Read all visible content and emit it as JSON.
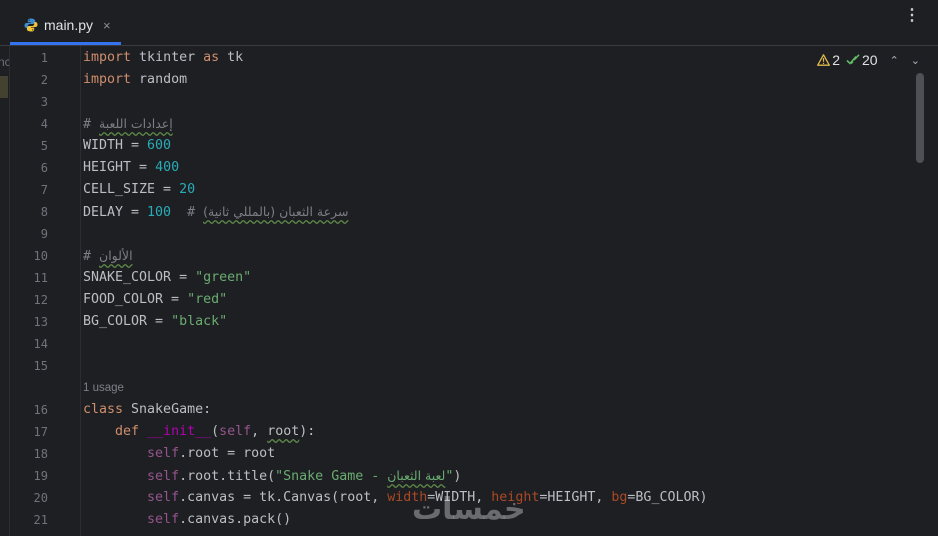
{
  "tab": {
    "filename": "main.py",
    "close": "×"
  },
  "menu": {
    "more": "⋮"
  },
  "left_strip": {
    "text": "nc"
  },
  "inspections": {
    "warnings": "2",
    "weak_warnings": "20",
    "prev": "⌃",
    "next": "⌄"
  },
  "line_numbers": [
    "1",
    "2",
    "3",
    "4",
    "5",
    "6",
    "7",
    "8",
    "9",
    "10",
    "11",
    "12",
    "13",
    "14",
    "15",
    "16",
    "17",
    "18",
    "19",
    "20",
    "21"
  ],
  "code": {
    "l1": {
      "k": "import",
      "t": " tkinter ",
      "k2": "as",
      "t2": " tk"
    },
    "l2": {
      "k": "import",
      "t": " random"
    },
    "l4": {
      "hash": "# ",
      "ar": "إعدادات اللعبة"
    },
    "l5": {
      "name": "WIDTH = ",
      "num": "600"
    },
    "l6": {
      "name": "HEIGHT = ",
      "num": "400"
    },
    "l7": {
      "name": "CELL_SIZE = ",
      "num": "20"
    },
    "l8": {
      "name": "DELAY = ",
      "num": "100",
      "hash": "  # ",
      "ar": "سرعة الثعبان (بالمللي ثانية)"
    },
    "l10": {
      "hash": "# ",
      "ar": "الألوان"
    },
    "l11": {
      "name": "SNAKE_COLOR = ",
      "str": "\"green\""
    },
    "l12": {
      "name": "FOOD_COLOR = ",
      "str": "\"red\""
    },
    "l13": {
      "name": "BG_COLOR = ",
      "str": "\"black\""
    },
    "usage": "1 usage",
    "l16": {
      "k": "class",
      "t": " SnakeGame:"
    },
    "l17": {
      "indent": "    ",
      "k": "def",
      "sp": " ",
      "fn": "__init__",
      "p1": "(",
      "self": "self",
      "p2": ", ",
      "root": "root",
      "p3": "):"
    },
    "l18": {
      "indent": "        ",
      "self": "self",
      "t": ".root = root"
    },
    "l19": {
      "indent": "        ",
      "self": "self",
      "t": ".root.title(",
      "q1": "\"Snake Game - ",
      "ar": "لعبة الثعبان",
      "q2": "\"",
      "t2": ")"
    },
    "l20": {
      "indent": "        ",
      "self": "self",
      "t": ".canvas = tk.Canvas(root, ",
      "a1": "width",
      "v1": "=WIDTH, ",
      "a2": "height",
      "v2": "=HEIGHT, ",
      "a3": "bg",
      "v3": "=BG_COLOR)"
    },
    "l21": {
      "indent": "        ",
      "self": "self",
      "t": ".canvas.pack()"
    }
  },
  "watermark": "خمسات",
  "colors": {
    "background": "#1e1f22",
    "keyword": "#cf8e6d",
    "number": "#2aacb8",
    "string": "#6aab73",
    "comment": "#7a7e85",
    "self": "#94558d",
    "dunder": "#b200b2",
    "param": "#aa4926",
    "accent": "#3574f0"
  }
}
